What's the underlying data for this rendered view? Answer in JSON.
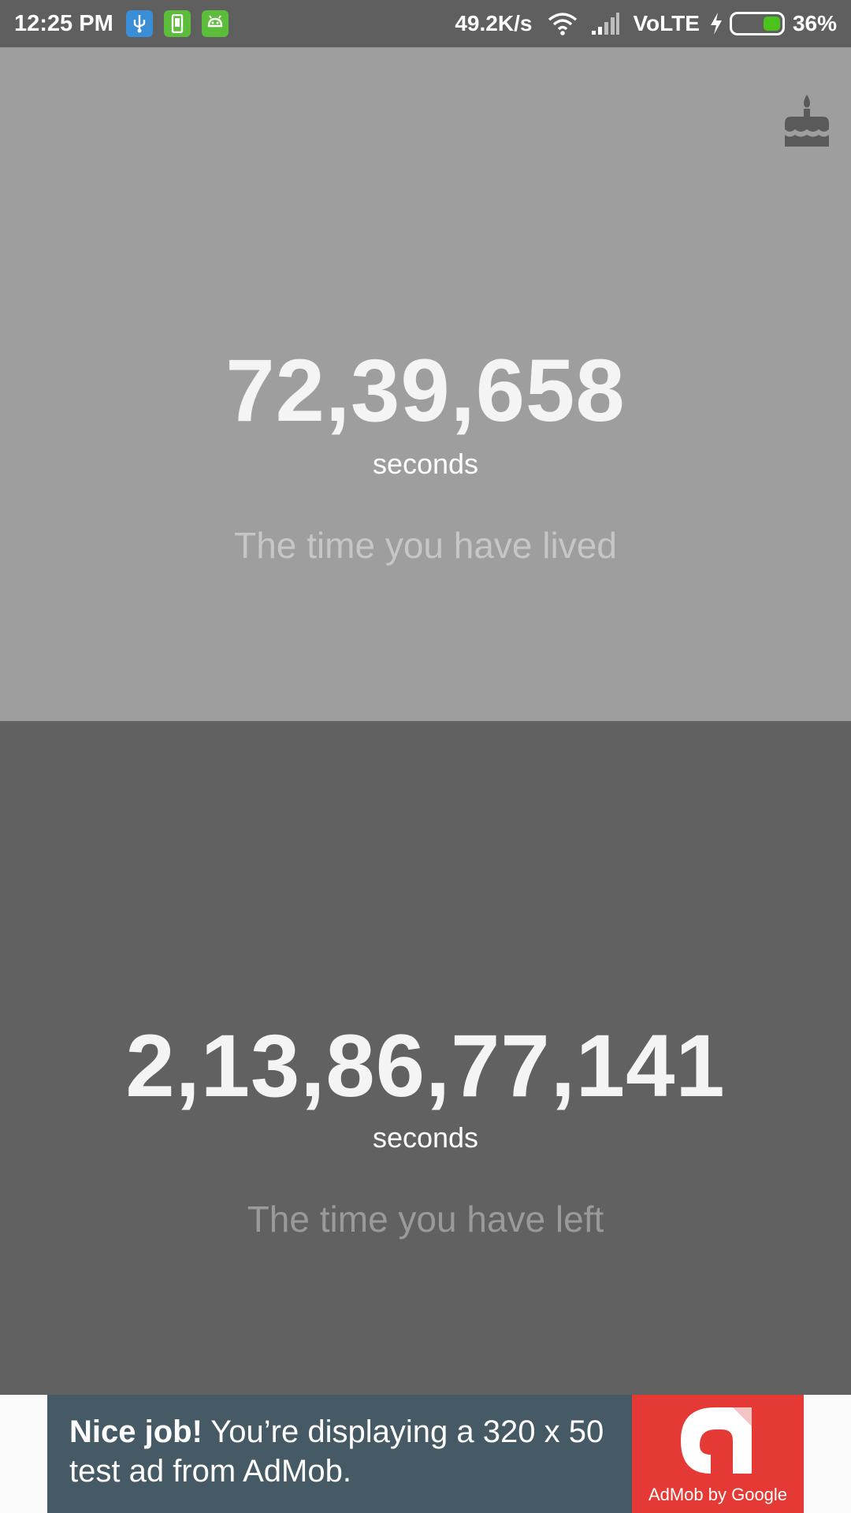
{
  "status_bar": {
    "time": "12:25 PM",
    "net_speed": "49.2K/s",
    "network": "VoLTE",
    "battery_percent": "36%",
    "battery_level": 0.36,
    "icons": [
      "usb-icon",
      "phone-icon",
      "android-icon",
      "wifi-icon",
      "signal-icon",
      "charging-icon",
      "battery-icon"
    ]
  },
  "lived": {
    "value": "72,39,658",
    "unit": "seconds",
    "caption": "The time you have lived"
  },
  "left": {
    "value": "2,13,86,77,141",
    "unit": "seconds",
    "caption": "The time you have left"
  },
  "toolbar": {
    "birthday_icon": "cake-icon"
  },
  "ad": {
    "headline": "Nice job!",
    "body_line1": " You’re displaying a 320 x 50",
    "body_line2": "test ad from AdMob.",
    "logo_caption": "AdMob by Google"
  },
  "colors": {
    "status_bar": "#5f5f5f",
    "panel_lived": "#9e9e9e",
    "panel_left": "#616161",
    "ad_background": "#455a64",
    "ad_logo": "#e53935"
  }
}
